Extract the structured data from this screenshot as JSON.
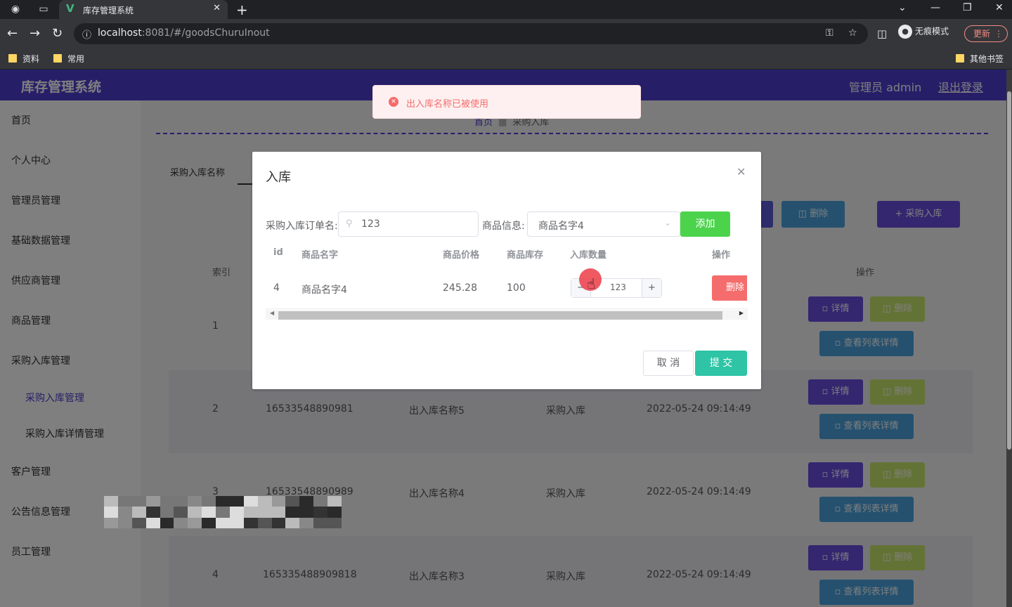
{
  "browser": {
    "tab_title": "库存管理系统",
    "tab_favicon": "V",
    "url_host": "localhost",
    "url_rest": ":8081/#/goodsChuruInout",
    "incognito_label": "无痕模式",
    "update_label": "更新",
    "bookmarks": [
      "资料",
      "常用"
    ],
    "other_bookmarks": "其他书签"
  },
  "app": {
    "title": "库存管理系统",
    "user": "管理员 admin",
    "logout": "退出登录"
  },
  "sidebar": {
    "items": [
      "首页",
      "个人中心",
      "管理员管理",
      "基础数据管理",
      "供应商管理",
      "商品管理",
      "采购入库管理"
    ],
    "sub_items": [
      "采购入库管理",
      "采购入库详情管理"
    ],
    "items_after": [
      "客户管理",
      "公告信息管理",
      "员工管理"
    ]
  },
  "main": {
    "breadcrumb": [
      "首页",
      "采购入库"
    ],
    "search_label": "采购入库名称",
    "toolbar": {
      "delete": "删除",
      "inbound": "采购入库"
    },
    "table_headers": {
      "index": "索引",
      "ops": "操作"
    },
    "row_buttons": {
      "detail": "详情",
      "delete": "删除",
      "list": "查看列表详情"
    },
    "rows": [
      {
        "index": "1",
        "code": "",
        "name": "",
        "type": "",
        "time": ""
      },
      {
        "index": "2",
        "code": "16533548890981",
        "name": "出入库名称5",
        "type": "采购入库",
        "time": "2022-05-24 09:14:49"
      },
      {
        "index": "3",
        "code": "16533548890989",
        "name": "出入库名称4",
        "type": "采购入库",
        "time": "2022-05-24 09:14:49"
      },
      {
        "index": "4",
        "code": "165335488909818",
        "name": "出入库名称3",
        "type": "采购入库",
        "time": "2022-05-24 09:14:49"
      }
    ]
  },
  "toast": {
    "message": "出入库名称已被使用",
    "color": "#f56c6c"
  },
  "dialog": {
    "title": "入库",
    "order_label": "采购入库订单名:",
    "order_value": "123",
    "goods_label": "商品信息:",
    "goods_value": "商品名字4",
    "add_label": "添加",
    "columns": [
      "id",
      "商品名字",
      "商品价格",
      "商品库存",
      "入库数量",
      "操作"
    ],
    "row": {
      "id": "4",
      "name": "商品名字4",
      "price": "245.28",
      "stock": "100",
      "qty": "123",
      "delete": "删除"
    },
    "cancel": "取 消",
    "submit": "提 交"
  },
  "colors": {
    "header": "#4c3fd0",
    "add": "#4cd34c",
    "submit": "#2ec4a5",
    "danger": "#f56c6c"
  }
}
